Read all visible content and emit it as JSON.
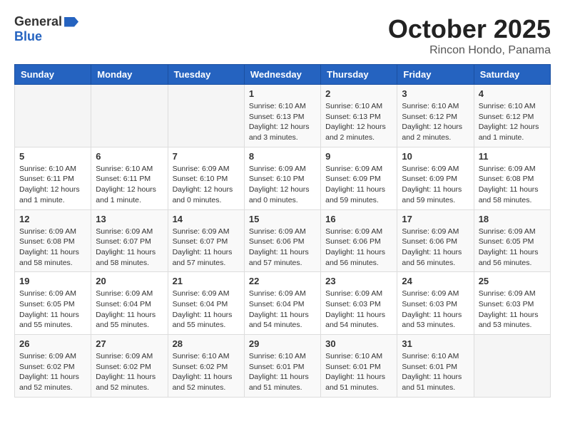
{
  "header": {
    "logo_general": "General",
    "logo_blue": "Blue",
    "title": "October 2025",
    "subtitle": "Rincon Hondo, Panama"
  },
  "calendar": {
    "weekdays": [
      "Sunday",
      "Monday",
      "Tuesday",
      "Wednesday",
      "Thursday",
      "Friday",
      "Saturday"
    ],
    "weeks": [
      [
        {
          "day": "",
          "info": ""
        },
        {
          "day": "",
          "info": ""
        },
        {
          "day": "",
          "info": ""
        },
        {
          "day": "1",
          "info": "Sunrise: 6:10 AM\nSunset: 6:13 PM\nDaylight: 12 hours and 3 minutes."
        },
        {
          "day": "2",
          "info": "Sunrise: 6:10 AM\nSunset: 6:13 PM\nDaylight: 12 hours and 2 minutes."
        },
        {
          "day": "3",
          "info": "Sunrise: 6:10 AM\nSunset: 6:12 PM\nDaylight: 12 hours and 2 minutes."
        },
        {
          "day": "4",
          "info": "Sunrise: 6:10 AM\nSunset: 6:12 PM\nDaylight: 12 hours and 1 minute."
        }
      ],
      [
        {
          "day": "5",
          "info": "Sunrise: 6:10 AM\nSunset: 6:11 PM\nDaylight: 12 hours and 1 minute."
        },
        {
          "day": "6",
          "info": "Sunrise: 6:10 AM\nSunset: 6:11 PM\nDaylight: 12 hours and 1 minute."
        },
        {
          "day": "7",
          "info": "Sunrise: 6:09 AM\nSunset: 6:10 PM\nDaylight: 12 hours and 0 minutes."
        },
        {
          "day": "8",
          "info": "Sunrise: 6:09 AM\nSunset: 6:10 PM\nDaylight: 12 hours and 0 minutes."
        },
        {
          "day": "9",
          "info": "Sunrise: 6:09 AM\nSunset: 6:09 PM\nDaylight: 11 hours and 59 minutes."
        },
        {
          "day": "10",
          "info": "Sunrise: 6:09 AM\nSunset: 6:09 PM\nDaylight: 11 hours and 59 minutes."
        },
        {
          "day": "11",
          "info": "Sunrise: 6:09 AM\nSunset: 6:08 PM\nDaylight: 11 hours and 58 minutes."
        }
      ],
      [
        {
          "day": "12",
          "info": "Sunrise: 6:09 AM\nSunset: 6:08 PM\nDaylight: 11 hours and 58 minutes."
        },
        {
          "day": "13",
          "info": "Sunrise: 6:09 AM\nSunset: 6:07 PM\nDaylight: 11 hours and 58 minutes."
        },
        {
          "day": "14",
          "info": "Sunrise: 6:09 AM\nSunset: 6:07 PM\nDaylight: 11 hours and 57 minutes."
        },
        {
          "day": "15",
          "info": "Sunrise: 6:09 AM\nSunset: 6:06 PM\nDaylight: 11 hours and 57 minutes."
        },
        {
          "day": "16",
          "info": "Sunrise: 6:09 AM\nSunset: 6:06 PM\nDaylight: 11 hours and 56 minutes."
        },
        {
          "day": "17",
          "info": "Sunrise: 6:09 AM\nSunset: 6:06 PM\nDaylight: 11 hours and 56 minutes."
        },
        {
          "day": "18",
          "info": "Sunrise: 6:09 AM\nSunset: 6:05 PM\nDaylight: 11 hours and 56 minutes."
        }
      ],
      [
        {
          "day": "19",
          "info": "Sunrise: 6:09 AM\nSunset: 6:05 PM\nDaylight: 11 hours and 55 minutes."
        },
        {
          "day": "20",
          "info": "Sunrise: 6:09 AM\nSunset: 6:04 PM\nDaylight: 11 hours and 55 minutes."
        },
        {
          "day": "21",
          "info": "Sunrise: 6:09 AM\nSunset: 6:04 PM\nDaylight: 11 hours and 55 minutes."
        },
        {
          "day": "22",
          "info": "Sunrise: 6:09 AM\nSunset: 6:04 PM\nDaylight: 11 hours and 54 minutes."
        },
        {
          "day": "23",
          "info": "Sunrise: 6:09 AM\nSunset: 6:03 PM\nDaylight: 11 hours and 54 minutes."
        },
        {
          "day": "24",
          "info": "Sunrise: 6:09 AM\nSunset: 6:03 PM\nDaylight: 11 hours and 53 minutes."
        },
        {
          "day": "25",
          "info": "Sunrise: 6:09 AM\nSunset: 6:03 PM\nDaylight: 11 hours and 53 minutes."
        }
      ],
      [
        {
          "day": "26",
          "info": "Sunrise: 6:09 AM\nSunset: 6:02 PM\nDaylight: 11 hours and 52 minutes."
        },
        {
          "day": "27",
          "info": "Sunrise: 6:09 AM\nSunset: 6:02 PM\nDaylight: 11 hours and 52 minutes."
        },
        {
          "day": "28",
          "info": "Sunrise: 6:10 AM\nSunset: 6:02 PM\nDaylight: 11 hours and 52 minutes."
        },
        {
          "day": "29",
          "info": "Sunrise: 6:10 AM\nSunset: 6:01 PM\nDaylight: 11 hours and 51 minutes."
        },
        {
          "day": "30",
          "info": "Sunrise: 6:10 AM\nSunset: 6:01 PM\nDaylight: 11 hours and 51 minutes."
        },
        {
          "day": "31",
          "info": "Sunrise: 6:10 AM\nSunset: 6:01 PM\nDaylight: 11 hours and 51 minutes."
        },
        {
          "day": "",
          "info": ""
        }
      ]
    ]
  }
}
